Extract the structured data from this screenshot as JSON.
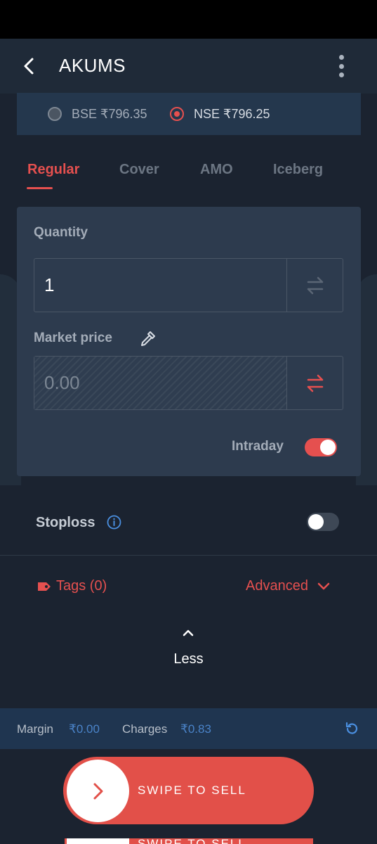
{
  "header": {
    "title": "AKUMS",
    "back_icon": "chevron-left-icon",
    "menu_icon": "more-vertical-icon"
  },
  "exchanges": [
    {
      "label": "BSE ₹796.35",
      "selected": false
    },
    {
      "label": "NSE ₹796.25",
      "selected": true
    }
  ],
  "order_tabs": [
    {
      "label": "Regular",
      "active": true
    },
    {
      "label": "Cover",
      "active": false
    },
    {
      "label": "AMO",
      "active": false
    },
    {
      "label": "Iceberg",
      "active": false
    }
  ],
  "form": {
    "quantity_label": "Quantity",
    "quantity_value": "1",
    "price_label": "Market price",
    "price_value": "0.00",
    "intraday_label": "Intraday",
    "intraday_on": true
  },
  "stoploss": {
    "label": "Stoploss",
    "enabled": false
  },
  "tags_label": "Tags (0)",
  "advanced_label": "Advanced",
  "less_label": "Less",
  "footer": {
    "margin_label": "Margin",
    "margin_value": "₹0.00",
    "charges_label": "Charges",
    "charges_value": "₹0.83"
  },
  "swipe": {
    "label": "SWIPE TO SELL"
  },
  "colors": {
    "accent": "#e5504f",
    "background": "#1b2330",
    "card": "#2d3b4e",
    "link": "#4a83c8"
  }
}
